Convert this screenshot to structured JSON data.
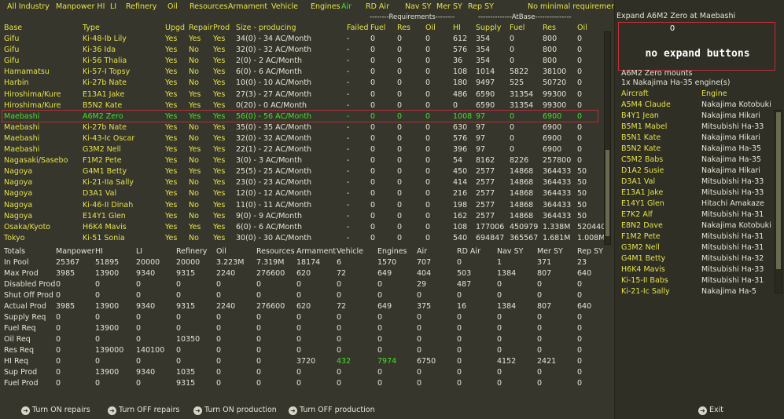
{
  "filters": [
    "All Industry",
    "Manpower HI",
    "LI",
    "Refinery",
    "Oil",
    "Resources",
    "Armament",
    "Vehicle",
    "Engines",
    "Air",
    "RD Air",
    "Nav SY",
    "Mer SY",
    "Rep SY",
    "No minimal requirement filter"
  ],
  "group_headers": {
    "requirements": "--------Requirements--------",
    "atbase": "--------------AtBase---------------"
  },
  "columns": [
    "Base",
    "Type",
    "Upgd",
    "Repair",
    "Prod",
    "Size - producing",
    "Failed",
    "Fuel",
    "Res",
    "Oil",
    "HI",
    "Supply",
    "Fuel",
    "Res",
    "Oil"
  ],
  "factories": [
    [
      "Gifu",
      "Ki-48-Ib Lily",
      "Yes",
      "Yes",
      "Yes",
      "34(0) - 34 AC/Month",
      "-",
      "0",
      "0",
      "0",
      "612",
      "354",
      "0",
      "800",
      "0"
    ],
    [
      "Gifu",
      "Ki-36 Ida",
      "Yes",
      "No",
      "Yes",
      "32(0) - 32 AC/Month",
      "-",
      "0",
      "0",
      "0",
      "576",
      "354",
      "0",
      "800",
      "0"
    ],
    [
      "Gifu",
      "Ki-56 Thalia",
      "Yes",
      "No",
      "Yes",
      "2(0) - 2 AC/Month",
      "-",
      "0",
      "0",
      "0",
      "36",
      "354",
      "0",
      "800",
      "0"
    ],
    [
      "Hamamatsu",
      "Ki-57-I Topsy",
      "Yes",
      "No",
      "Yes",
      "6(0) - 6 AC/Month",
      "-",
      "0",
      "0",
      "0",
      "108",
      "1014",
      "5822",
      "38100",
      "0"
    ],
    [
      "Harbin",
      "Ki-27b Nate",
      "Yes",
      "No",
      "Yes",
      "10(0) - 10 AC/Month",
      "-",
      "0",
      "0",
      "0",
      "180",
      "9497",
      "525",
      "50720",
      "0"
    ],
    [
      "Hiroshima/Kure",
      "E13A1 Jake",
      "Yes",
      "Yes",
      "Yes",
      "27(3) - 27 AC/Month",
      "-",
      "0",
      "0",
      "0",
      "486",
      "6590",
      "31354",
      "99300",
      "0"
    ],
    [
      "Hiroshima/Kure",
      "B5N2 Kate",
      "Yes",
      "Yes",
      "Yes",
      "0(20) - 0 AC/Month",
      "-",
      "0",
      "0",
      "0",
      "0",
      "6590",
      "31354",
      "99300",
      "0"
    ],
    [
      "Maebashi",
      "A6M2 Zero",
      "Yes",
      "Yes",
      "Yes",
      "56(0) - 56 AC/Month",
      "-",
      "0",
      "0",
      "0",
      "1008",
      "97",
      "0",
      "6900",
      "0"
    ],
    [
      "Maebashi",
      "Ki-27b Nate",
      "Yes",
      "No",
      "Yes",
      "35(0) - 35 AC/Month",
      "-",
      "0",
      "0",
      "0",
      "630",
      "97",
      "0",
      "6900",
      "0"
    ],
    [
      "Maebashi",
      "Ki-43-Ic Oscar",
      "Yes",
      "No",
      "Yes",
      "32(0) - 32 AC/Month",
      "-",
      "0",
      "0",
      "0",
      "576",
      "97",
      "0",
      "6900",
      "0"
    ],
    [
      "Maebashi",
      "G3M2 Nell",
      "Yes",
      "Yes",
      "Yes",
      "22(1) - 22 AC/Month",
      "-",
      "0",
      "0",
      "0",
      "396",
      "97",
      "0",
      "6900",
      "0"
    ],
    [
      "Nagasaki/Sasebo",
      "F1M2 Pete",
      "Yes",
      "No",
      "Yes",
      "3(0) - 3 AC/Month",
      "-",
      "0",
      "0",
      "0",
      "54",
      "8162",
      "8226",
      "257800",
      "0"
    ],
    [
      "Nagoya",
      "G4M1 Betty",
      "Yes",
      "Yes",
      "Yes",
      "25(5) - 25 AC/Month",
      "-",
      "0",
      "0",
      "0",
      "450",
      "2577",
      "14868",
      "364433",
      "50"
    ],
    [
      "Nagoya",
      "Ki-21-IIa Sally",
      "Yes",
      "No",
      "Yes",
      "23(0) - 23 AC/Month",
      "-",
      "0",
      "0",
      "0",
      "414",
      "2577",
      "14868",
      "364433",
      "50"
    ],
    [
      "Nagoya",
      "D3A1 Val",
      "Yes",
      "No",
      "Yes",
      "12(0) - 12 AC/Month",
      "-",
      "0",
      "0",
      "0",
      "216",
      "2577",
      "14868",
      "364433",
      "50"
    ],
    [
      "Nagoya",
      "Ki-46-II Dinah",
      "Yes",
      "No",
      "Yes",
      "11(0) - 11 AC/Month",
      "-",
      "0",
      "0",
      "0",
      "198",
      "2577",
      "14868",
      "364433",
      "50"
    ],
    [
      "Nagoya",
      "E14Y1 Glen",
      "Yes",
      "No",
      "Yes",
      "9(0) - 9 AC/Month",
      "-",
      "0",
      "0",
      "0",
      "162",
      "2577",
      "14868",
      "364433",
      "50"
    ],
    [
      "Osaka/Kyoto",
      "H6K4 Mavis",
      "Yes",
      "Yes",
      "Yes",
      "6(0) - 6 AC/Month",
      "-",
      "0",
      "0",
      "0",
      "108",
      "177006",
      "450979",
      "1.338M",
      "520440"
    ],
    [
      "Tokyo",
      "Ki-51 Sonia",
      "Yes",
      "No",
      "Yes",
      "30(0) - 30 AC/Month",
      "-",
      "0",
      "0",
      "0",
      "540",
      "694847",
      "365567",
      "1.681M",
      "1.008M"
    ]
  ],
  "selected_row_index": 7,
  "totals_header": [
    "Totals",
    "Manpower",
    "HI",
    "LI",
    "Refinery",
    "Oil",
    "Resources",
    "Armament",
    "Vehicle",
    "Engines",
    "Air",
    "RD Air",
    "Nav SY",
    "Mer SY",
    "Rep SY"
  ],
  "totals": [
    [
      "In Pool",
      "25367",
      "51895",
      "20000",
      "20000",
      "3.223M",
      "7.319M",
      "18174",
      "6",
      "1570",
      "707",
      "0",
      "1",
      "371",
      "23"
    ],
    [
      "Max Prod",
      "3985",
      "13900",
      "9340",
      "9315",
      "2240",
      "276600",
      "620",
      "72",
      "649",
      "404",
      "503",
      "1384",
      "807",
      "640"
    ],
    [
      "Disabled Prod",
      "0",
      "0",
      "0",
      "0",
      "0",
      "0",
      "0",
      "0",
      "0",
      "29",
      "487",
      "0",
      "0",
      "0"
    ],
    [
      "Shut Off Prod",
      "0",
      "0",
      "0",
      "0",
      "0",
      "0",
      "0",
      "0",
      "0",
      "0",
      "0",
      "0",
      "0",
      "0"
    ],
    [
      "Actual Prod",
      "3985",
      "13900",
      "9340",
      "9315",
      "2240",
      "276600",
      "620",
      "72",
      "649",
      "375",
      "16",
      "1384",
      "807",
      "640"
    ],
    [
      "Supply Req",
      "0",
      "0",
      "0",
      "0",
      "0",
      "0",
      "0",
      "0",
      "0",
      "0",
      "0",
      "0",
      "0",
      "0"
    ],
    [
      "Fuel Req",
      "0",
      "13900",
      "0",
      "0",
      "0",
      "0",
      "0",
      "0",
      "0",
      "0",
      "0",
      "0",
      "0",
      "0"
    ],
    [
      "Oil Req",
      "0",
      "0",
      "0",
      "10350",
      "0",
      "0",
      "0",
      "0",
      "0",
      "0",
      "0",
      "0",
      "0",
      "0"
    ],
    [
      "Res Req",
      "0",
      "139000",
      "140100",
      "0",
      "0",
      "0",
      "0",
      "0",
      "0",
      "0",
      "0",
      "0",
      "0",
      "0"
    ],
    [
      "HI Req",
      "0",
      "0",
      "0",
      "0",
      "0",
      "0",
      "3720",
      "432",
      "7974",
      "6750",
      "0",
      "4152",
      "2421",
      "0"
    ],
    [
      "Sup Prod",
      "0",
      "13900",
      "9340",
      "1035",
      "0",
      "0",
      "0",
      "0",
      "0",
      "0",
      "0",
      "0",
      "0",
      "0"
    ],
    [
      "Fuel Prod",
      "0",
      "0",
      "0",
      "9315",
      "0",
      "0",
      "0",
      "0",
      "0",
      "0",
      "0",
      "0",
      "0",
      "0"
    ]
  ],
  "highlight_cells": [
    [
      9,
      8
    ],
    [
      9,
      9
    ]
  ],
  "bottom_buttons": [
    "Turn ON repairs",
    "Turn OFF repairs",
    "Turn ON production",
    "Turn OFF production"
  ],
  "right": {
    "expand_title": "Expand A6M2 Zero at Maebashi",
    "expand_count": "0",
    "no_expand_msg": "no expand buttons",
    "mounts_title": "A6M2 Zero mounts",
    "mounts_detail": "1x Nakajima Ha-35 engine(s)",
    "col_aircraft": "Aircraft",
    "col_engine": "Engine",
    "items": [
      [
        "A5M4 Claude",
        "Nakajima Kotobuki"
      ],
      [
        "B4Y1 Jean",
        "Nakajima Hikari"
      ],
      [
        "B5M1 Mabel",
        "Mitsubishi Ha-33"
      ],
      [
        "B5N1 Kate",
        "Nakajima Hikari"
      ],
      [
        "B5N2 Kate",
        "Nakajima Ha-35"
      ],
      [
        "C5M2 Babs",
        "Nakajima Ha-35"
      ],
      [
        "D1A2 Susie",
        "Nakajima Hikari"
      ],
      [
        "D3A1 Val",
        "Mitsubishi Ha-33"
      ],
      [
        "E13A1 Jake",
        "Mitsubishi Ha-33"
      ],
      [
        "E14Y1 Glen",
        "Hitachi Amakaze"
      ],
      [
        "E7K2 Alf",
        "Mitsubishi Ha-31"
      ],
      [
        "E8N2 Dave",
        "Nakajima Kotobuki"
      ],
      [
        "F1M2 Pete",
        "Mitsubishi Ha-31"
      ],
      [
        "G3M2 Nell",
        "Mitsubishi Ha-31"
      ],
      [
        "G4M1 Betty",
        "Mitsubishi Ha-32"
      ],
      [
        "H6K4 Mavis",
        "Mitsubishi Ha-33"
      ],
      [
        "Ki-15-II Babs",
        "Mitsubishi Ha-31"
      ],
      [
        "Ki-21-Ic Sally",
        "Nakajima Ha-5"
      ]
    ],
    "exit_label": "Exit"
  },
  "colors": {
    "yellow": "#e6e14a",
    "white": "#e4e4d6",
    "green": "#44e02a",
    "selection_border": "#b0303a",
    "background": "#36362c"
  }
}
